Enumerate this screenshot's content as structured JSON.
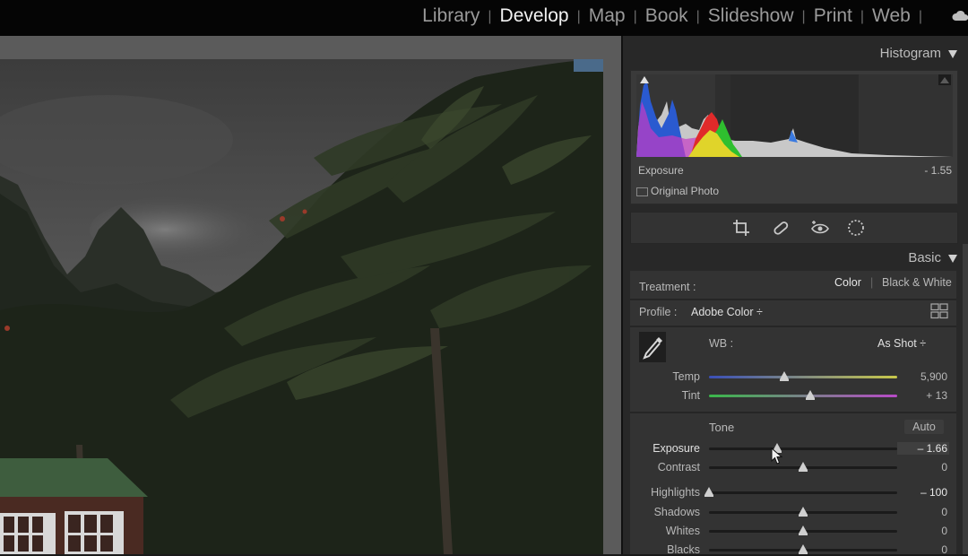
{
  "modules": [
    {
      "label": "Library",
      "active": false
    },
    {
      "label": "Develop",
      "active": true
    },
    {
      "label": "Map",
      "active": false
    },
    {
      "label": "Book",
      "active": false
    },
    {
      "label": "Slideshow",
      "active": false
    },
    {
      "label": "Print",
      "active": false
    },
    {
      "label": "Web",
      "active": false
    }
  ],
  "icons": {
    "cloud": "cloud-icon",
    "crop": "crop-icon",
    "heal": "healing-icon",
    "redeye": "red-eye-icon",
    "mask": "masking-icon",
    "eyedropper": "eyedropper-icon",
    "grid": "profile-browser-icon"
  },
  "histogram": {
    "title": "Histogram",
    "info_label": "Exposure",
    "info_value": "- 1.55",
    "original_photo": "Original Photo"
  },
  "basic": {
    "title": "Basic",
    "treatment_label": "Treatment :",
    "treatment_color": "Color",
    "treatment_bw": "Black & White",
    "profile_label": "Profile :",
    "profile_value": "Adobe Color ÷",
    "wb_label": "WB :",
    "wb_value": "As Shot ÷",
    "tone_label": "Tone",
    "auto_label": "Auto",
    "sliders": [
      {
        "label": "Temp",
        "value": "5,900",
        "level": 0.4
      },
      {
        "label": "Tint",
        "value": "+ 13",
        "level": 0.54
      },
      {
        "label": "Exposure",
        "value": "– 1.66",
        "level": 0.36
      },
      {
        "label": "Contrast",
        "value": "0",
        "level": 0.5
      },
      {
        "label": "Highlights",
        "value": "– 100",
        "level": 0.0
      },
      {
        "label": "Shadows",
        "value": "0",
        "level": 0.5
      },
      {
        "label": "Whites",
        "value": "0",
        "level": 0.5
      },
      {
        "label": "Blacks",
        "value": "0",
        "level": 0.5
      }
    ]
  }
}
